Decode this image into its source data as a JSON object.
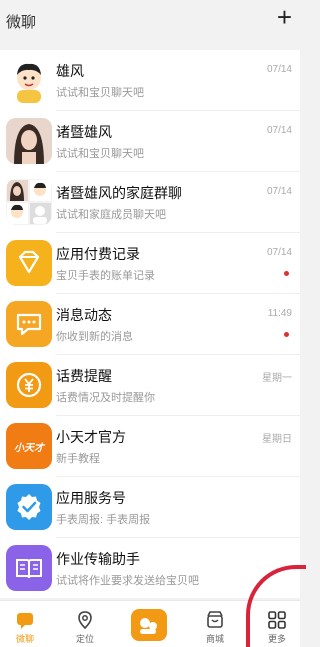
{
  "header": {
    "title": "微聊",
    "add_icon": "plus-icon"
  },
  "chats": [
    {
      "name": "雄风",
      "preview": "试试和宝贝聊天吧",
      "time": "07/14",
      "unread": false,
      "avatar": "boy-cartoon-avatar"
    },
    {
      "name": "诸暨雄风",
      "preview": "试试和宝贝聊天吧",
      "time": "07/14",
      "unread": false,
      "avatar": "photo-avatar"
    },
    {
      "name": "诸暨雄风的家庭群聊",
      "preview": "试试和家庭成员聊天吧",
      "time": "07/14",
      "unread": false,
      "avatar": "group-avatar"
    },
    {
      "name": "应用付费记录",
      "preview": "宝贝手表的账单记录",
      "time": "07/14",
      "unread": true,
      "avatar": "diamond-icon",
      "color": "#f5b21c"
    },
    {
      "name": "消息动态",
      "preview": "你收到新的消息",
      "time": "11:49",
      "unread": true,
      "avatar": "message-icon",
      "color": "#f5a623"
    },
    {
      "name": "话费提醒",
      "preview": "话费情况及时提醒你",
      "time": "星期一",
      "unread": false,
      "avatar": "yuan-coin-icon",
      "color": "#f39a14"
    },
    {
      "name": "小天才官方",
      "preview": "新手教程",
      "time": "星期日",
      "unread": false,
      "avatar": "brand-logo-icon",
      "color": "#f07c13",
      "logo_text": "小天才"
    },
    {
      "name": "应用服务号",
      "preview": "手表周报: 手表周报",
      "time": "",
      "unread": false,
      "avatar": "check-badge-icon",
      "color": "#2f9be8"
    },
    {
      "name": "作业传输助手",
      "preview": "试试将作业要求发送给宝贝吧",
      "time": "",
      "unread": false,
      "avatar": "book-icon",
      "color": "#8a63e8"
    }
  ],
  "tabbar": [
    {
      "label": "微聊",
      "icon": "chat-icon",
      "active": true
    },
    {
      "label": "定位",
      "icon": "location-pin-icon",
      "active": false
    },
    {
      "label": "",
      "icon": "center-action-icon",
      "active": false
    },
    {
      "label": "商城",
      "icon": "store-icon",
      "active": false
    },
    {
      "label": "更多",
      "icon": "grid-icon",
      "active": false
    }
  ],
  "colors": {
    "accent": "#f39a14",
    "unread": "#e03030",
    "annotation": "#d8233b"
  }
}
